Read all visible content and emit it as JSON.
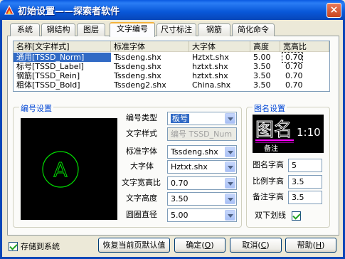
{
  "window": {
    "title": "初始设置——探索者软件",
    "close_label": "×"
  },
  "tabs": [
    {
      "label": "系统"
    },
    {
      "label": "钢结构"
    },
    {
      "label": "图层"
    },
    {
      "label": "文字编号"
    },
    {
      "label": "尺寸标注"
    },
    {
      "label": "钢筋"
    },
    {
      "label": "简化命令"
    }
  ],
  "active_tab": "文字编号",
  "style_table": {
    "headers": [
      "名称[文字样式]",
      "标准字体",
      "大字体",
      "高度",
      "宽高比"
    ],
    "rows": [
      [
        "通用[TSSD_Norm]",
        "Tssdeng.shx",
        "Hztxt.shx",
        "5.00",
        "0.70"
      ],
      [
        "标号[TSSD_Label]",
        "Tssdeng.shx",
        "hztxt.shx",
        "3.50",
        "0.70"
      ],
      [
        "钢筋[TSSD_Rein]",
        "Tssdeng.shx",
        "hztxt.shx",
        "3.50",
        "0.70"
      ],
      [
        "粗体[TSSD_Bold]",
        "Tssdeng2.shx",
        "China.shx",
        "3.50",
        "0.70"
      ]
    ],
    "selected_row": 0
  },
  "numbering": {
    "title": "编号设置",
    "preview_letter": "A",
    "fields": {
      "type_label": "编号类型",
      "type_value": "板号",
      "style_label": "文字样式",
      "style_value": "编号 TSSD_Num",
      "std_font_label": "标准字体",
      "std_font_value": "Tssdeng.shx",
      "big_font_label": "大字体",
      "big_font_value": "Hztxt.shx",
      "ratio_label": "文字宽高比",
      "ratio_value": "0.70",
      "height_label": "文字高度",
      "height_value": "3.50",
      "circle_label": "圆圈直径",
      "circle_value": "5.00"
    }
  },
  "figname": {
    "title": "图名设置",
    "preview_main": "图名",
    "preview_scale": "1:10",
    "preview_note": "备注",
    "name_height_label": "图名字高",
    "name_height_value": "5",
    "scale_height_label": "比例字高",
    "scale_height_value": "3.5",
    "note_height_label": "备注字高",
    "note_height_value": "3.5",
    "double_underline_label": "双下划线",
    "double_underline_checked": true
  },
  "footer": {
    "save_to_system_label": "存储到系统",
    "save_to_system_checked": true,
    "restore_default": "恢复当前页默认值",
    "ok": "确定",
    "ok_key": "O",
    "cancel": "取消",
    "cancel_key": "C",
    "help": "帮助",
    "help_key": "H"
  },
  "colors": {
    "titlebar": "#0857d8",
    "accent_blue": "#0046d5",
    "selection": "#316ac5",
    "preview_green": "#00e000",
    "preview_magenta": "#ff00ff"
  }
}
